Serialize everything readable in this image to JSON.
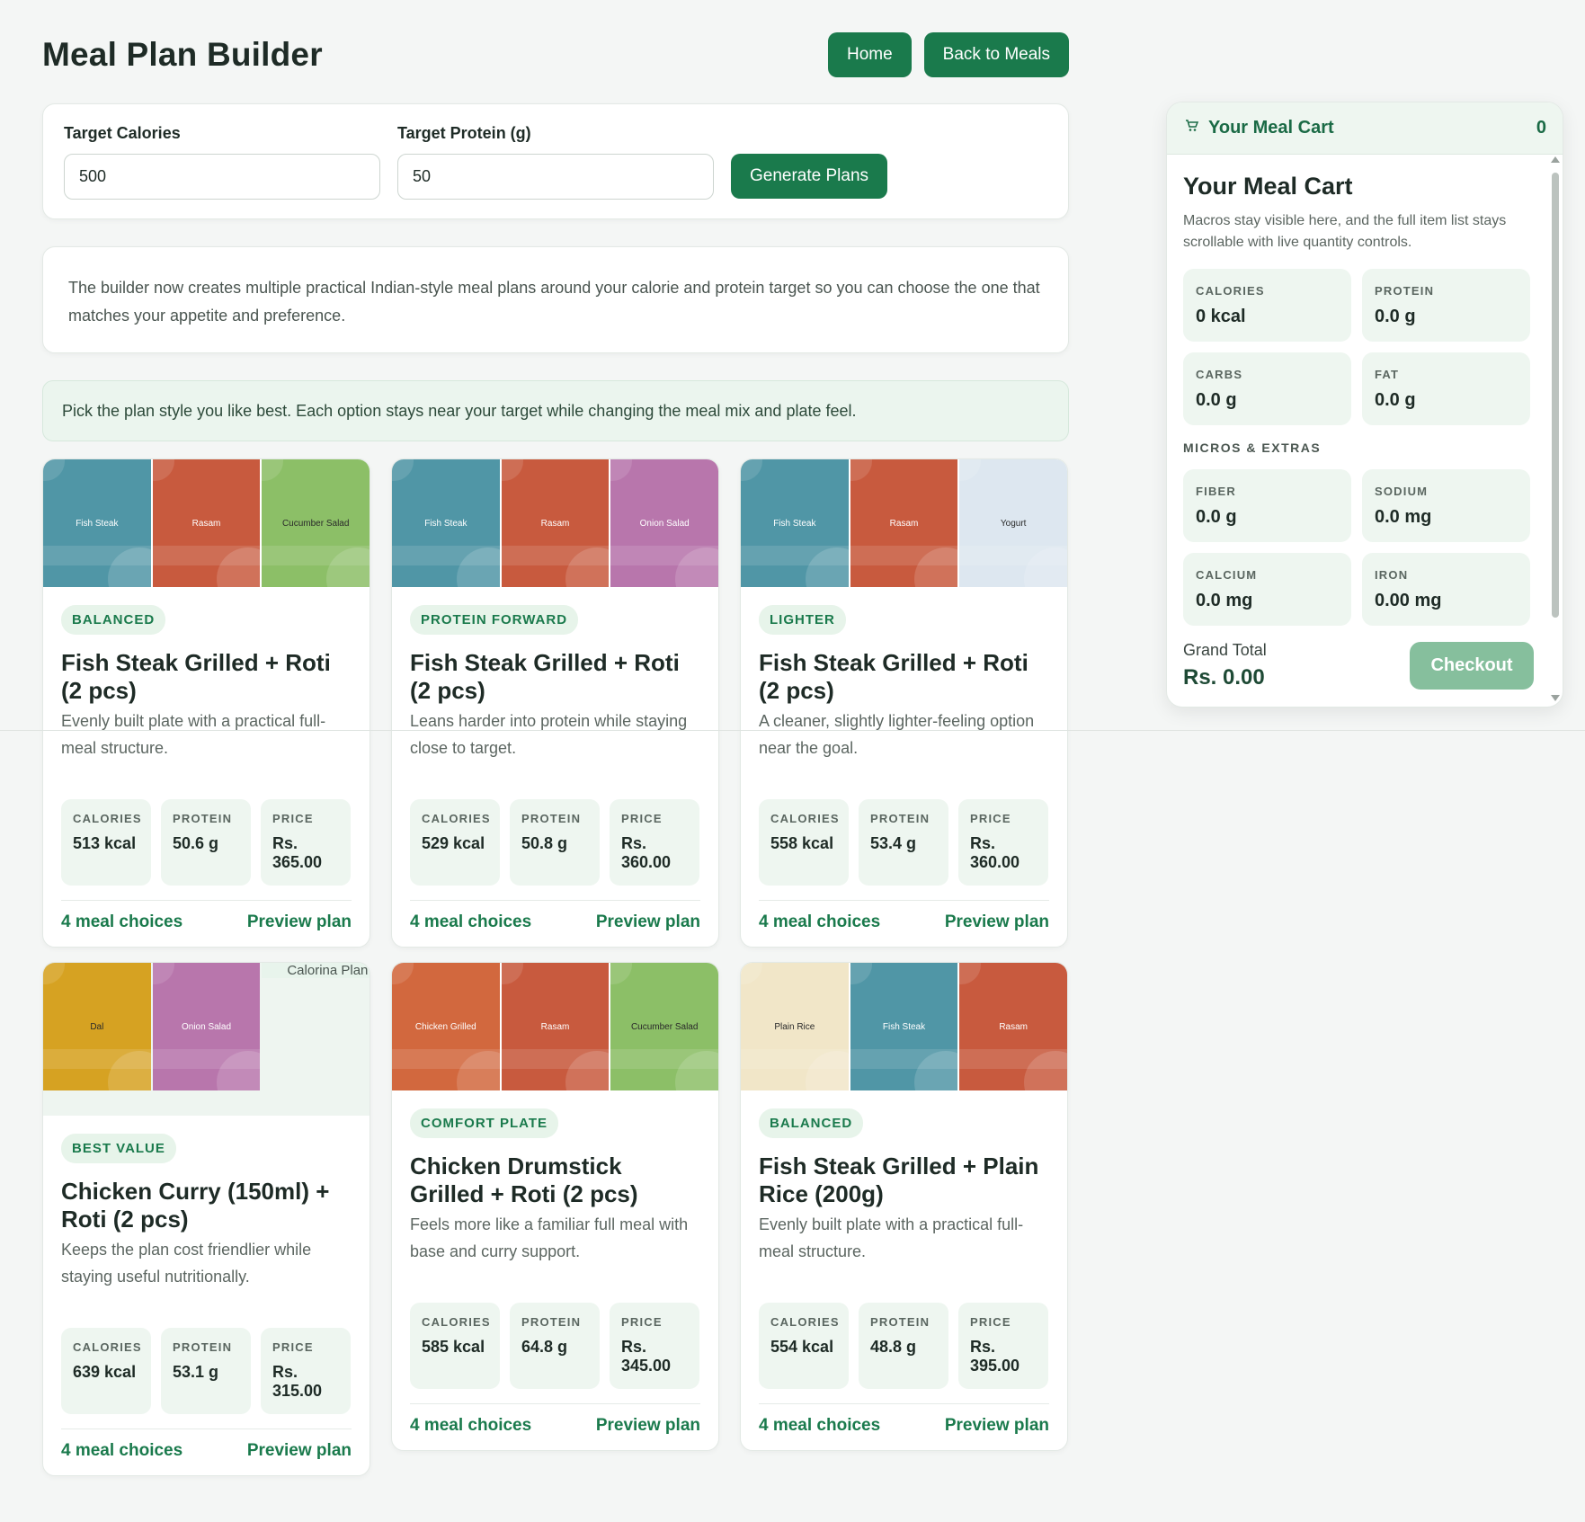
{
  "header": {
    "title": "Meal Plan Builder",
    "home_label": "Home",
    "back_label": "Back to Meals"
  },
  "targets": {
    "calories_label": "Target Calories",
    "calories_value": "500",
    "protein_label": "Target Protein (g)",
    "protein_value": "50",
    "generate_label": "Generate Plans"
  },
  "info": "The builder now creates multiple practical Indian-style meal plans around your calorie and protein target so you can choose the one that matches your appetite and preference.",
  "hint": "Pick the plan style you like best. Each option stays near your target while changing the meal mix and plate feel.",
  "stat_labels": {
    "calories": "CALORIES",
    "protein": "PROTEIN",
    "price": "PRICE"
  },
  "plans": [
    {
      "badge": "BALANCED",
      "title": "Fish Steak Grilled + Roti (2 pcs)",
      "desc": "Evenly built plate with a practical full-meal structure.",
      "calories": "513 kcal",
      "protein": "50.6 g",
      "price": "Rs. 365.00",
      "choices": "4 meal choices",
      "preview": "Preview plan",
      "thumbs": [
        {
          "name": "Fish Steak",
          "color": "#5096a6"
        },
        {
          "name": "Rasam",
          "color": "#c85a3e"
        },
        {
          "name": "Cucumber Salad",
          "color": "#8cbf67"
        }
      ]
    },
    {
      "badge": "PROTEIN FORWARD",
      "title": "Fish Steak Grilled + Roti (2 pcs)",
      "desc": "Leans harder into protein while staying close to target.",
      "calories": "529 kcal",
      "protein": "50.8 g",
      "price": "Rs. 360.00",
      "choices": "4 meal choices",
      "preview": "Preview plan",
      "thumbs": [
        {
          "name": "Fish Steak",
          "color": "#5096a6"
        },
        {
          "name": "Rasam",
          "color": "#c85a3e"
        },
        {
          "name": "Onion Salad",
          "color": "#b876ac"
        }
      ]
    },
    {
      "badge": "LIGHTER",
      "title": "Fish Steak Grilled + Roti (2 pcs)",
      "desc": "A cleaner, slightly lighter-feeling option near the goal.",
      "calories": "558 kcal",
      "protein": "53.4 g",
      "price": "Rs. 360.00",
      "choices": "4 meal choices",
      "preview": "Preview plan",
      "thumbs": [
        {
          "name": "Fish Steak",
          "color": "#5096a6"
        },
        {
          "name": "Rasam",
          "color": "#c85a3e"
        },
        {
          "name": "Yogurt",
          "color": "#dde7f0"
        }
      ]
    },
    {
      "badge": "BEST VALUE",
      "title": "Chicken Curry (150ml) + Roti (2 pcs)",
      "desc": "Keeps the plan cost friendlier while staying useful nutritionally.",
      "calories": "639 kcal",
      "protein": "53.1 g",
      "price": "Rs. 315.00",
      "choices": "4 meal choices",
      "preview": "Preview plan",
      "thumbs": [
        {
          "name": "Dal",
          "color": "#d6a222"
        },
        {
          "name": "Onion Salad",
          "color": "#b876ac"
        },
        {
          "name": "Calorina Plan",
          "color": "#e8f4ec"
        }
      ]
    },
    {
      "badge": "COMFORT PLATE",
      "title": "Chicken Drumstick Grilled + Roti (2 pcs)",
      "desc": "Feels more like a familiar full meal with base and curry support.",
      "calories": "585 kcal",
      "protein": "64.8 g",
      "price": "Rs. 345.00",
      "choices": "4 meal choices",
      "preview": "Preview plan",
      "thumbs": [
        {
          "name": "Chicken Grilled",
          "color": "#d2683e"
        },
        {
          "name": "Rasam",
          "color": "#c85a3e"
        },
        {
          "name": "Cucumber Salad",
          "color": "#8cbf67"
        }
      ]
    },
    {
      "badge": "BALANCED",
      "title": "Fish Steak Grilled + Plain Rice (200g)",
      "desc": "Evenly built plate with a practical full-meal structure.",
      "calories": "554 kcal",
      "protein": "48.8 g",
      "price": "Rs. 395.00",
      "choices": "4 meal choices",
      "preview": "Preview plan",
      "thumbs": [
        {
          "name": "Plain Rice",
          "color": "#f1e6c8"
        },
        {
          "name": "Fish Steak",
          "color": "#5096a6"
        },
        {
          "name": "Rasam",
          "color": "#c85a3e"
        }
      ]
    }
  ],
  "cart": {
    "header_title": "Your Meal Cart",
    "count": "0",
    "title": "Your Meal Cart",
    "subtitle": "Macros stay visible here, and the full item list stays scrollable with live quantity controls.",
    "macros": [
      {
        "label": "CALORIES",
        "value": "0 kcal"
      },
      {
        "label": "PROTEIN",
        "value": "0.0 g"
      },
      {
        "label": "CARBS",
        "value": "0.0 g"
      },
      {
        "label": "FAT",
        "value": "0.0 g"
      }
    ],
    "micros_label": "MICROS & EXTRAS",
    "micros": [
      {
        "label": "FIBER",
        "value": "0.0 g"
      },
      {
        "label": "SODIUM",
        "value": "0.0 mg"
      },
      {
        "label": "CALCIUM",
        "value": "0.0 mg"
      },
      {
        "label": "IRON",
        "value": "0.00 mg"
      }
    ],
    "grand_total_label": "Grand Total",
    "grand_total": "Rs. 0.00",
    "checkout_label": "Checkout"
  }
}
